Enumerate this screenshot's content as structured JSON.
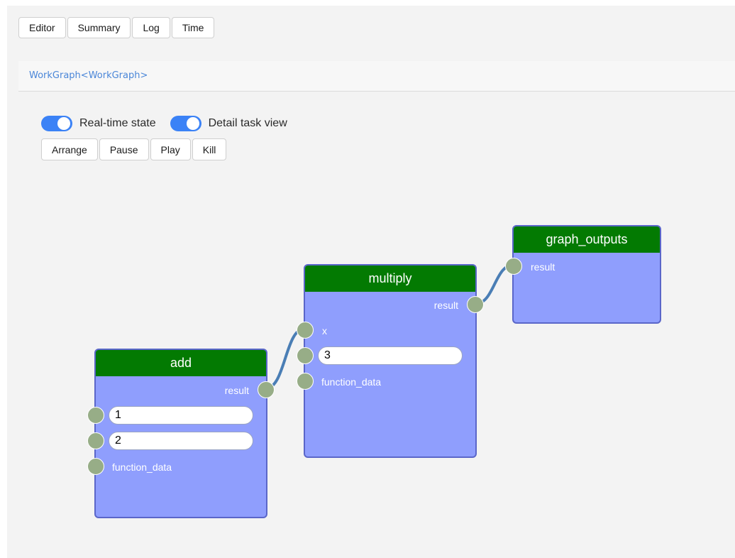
{
  "tabs": [
    "Editor",
    "Summary",
    "Log",
    "Time"
  ],
  "breadcrumb": "WorkGraph<WorkGraph>",
  "toggles": {
    "realtime": {
      "label": "Real-time state",
      "on": true
    },
    "detail": {
      "label": "Detail task view",
      "on": true
    }
  },
  "actions": [
    "Arrange",
    "Pause",
    "Play",
    "Kill"
  ],
  "colors": {
    "node_header": "#037a02",
    "node_body": "#8f9efd",
    "socket": "#97ad87",
    "link": "#4a7eb5",
    "toggle_on": "#3b82f6"
  },
  "nodes": {
    "add": {
      "title": "add",
      "output_label": "result",
      "input1_value": "1",
      "input2_value": "2",
      "function_data_label": "function_data"
    },
    "multiply": {
      "title": "multiply",
      "output_label": "result",
      "x_label": "x",
      "input_value": "3",
      "function_data_label": "function_data"
    },
    "graph_outputs": {
      "title": "graph_outputs",
      "input_label": "result"
    }
  }
}
